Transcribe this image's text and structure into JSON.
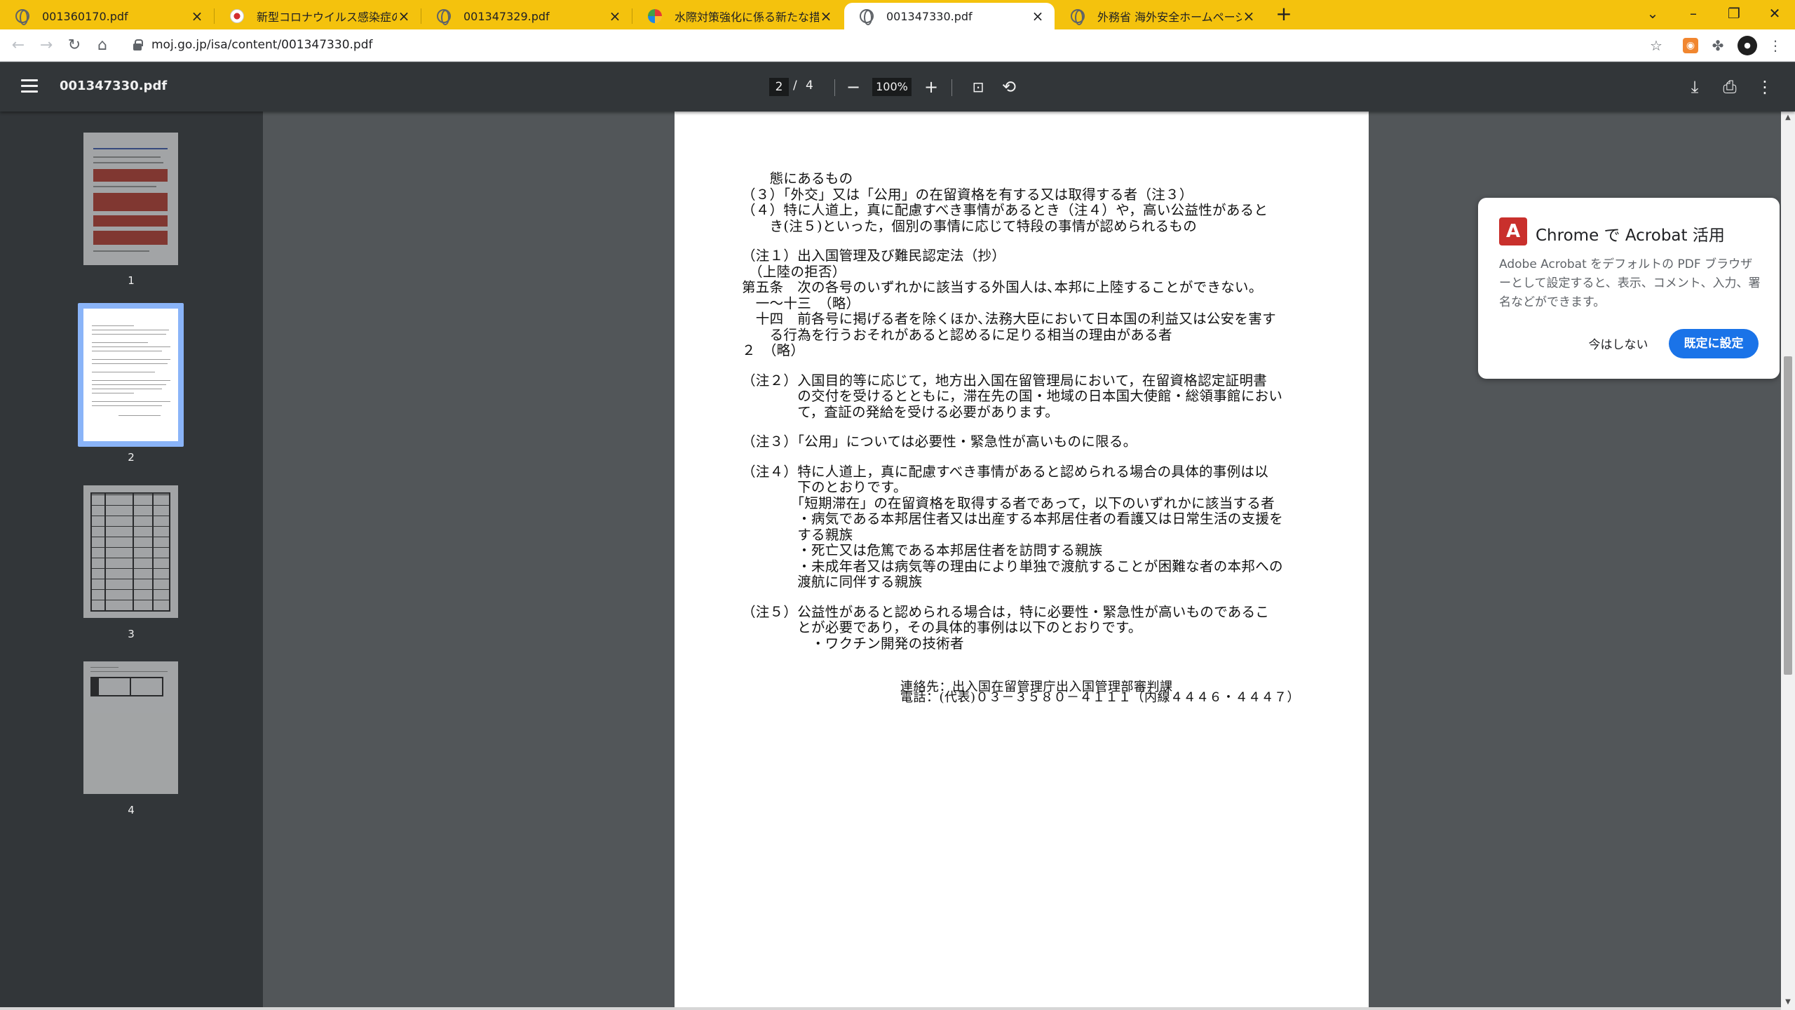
{
  "tabs": [
    {
      "title": "001360170.pdf",
      "icon": "globe-icon"
    },
    {
      "title": "新型コロナウイルス感染症の拡大防止",
      "icon": "flag-icon"
    },
    {
      "title": "001347329.pdf",
      "icon": "globe-icon"
    },
    {
      "title": "水際対策強化に係る新たな措置（",
      "icon": "emblem-icon"
    },
    {
      "title": "001347330.pdf",
      "icon": "globe-icon",
      "active": true
    },
    {
      "title": "外務省 海外安全ホームページ",
      "icon": "globe-icon"
    }
  ],
  "address": {
    "url": "moj.go.jp/isa/content/001347330.pdf"
  },
  "pdf": {
    "filename": "001347330.pdf",
    "current_page": "2",
    "page_separator": "/",
    "total_pages": "4",
    "zoom": "100%"
  },
  "thumbnails": [
    {
      "label": "1"
    },
    {
      "label": "2"
    },
    {
      "label": "3"
    },
    {
      "label": "4"
    }
  ],
  "document": {
    "lines": [
      "　　態にあるもの",
      "（３）「外交」又は「公用」の在留資格を有する又は取得する者（注３）",
      "（４）特に人道上，真に配慮すべき事情があるとき（注４）や，高い公益性があると",
      "　　き(注５)といった，個別の事情に応じて特段の事情が認められるもの",
      "",
      "（注１）出入国管理及び難民認定法（抄）",
      "　（上陸の拒否）",
      "第五条　次の各号のいずれかに該当する外国人は､本邦に上陸することができない。",
      "　一～十三　（略）",
      "　十四　前各号に掲げる者を除くほか､法務大臣において日本国の利益又は公安を害す",
      "　　る行為を行うおそれがあると認めるに足りる相当の理由がある者",
      "２　（略）",
      "",
      "（注２）入国目的等に応じて，地方出入国在留管理局において，在留資格認定証明書",
      "　　　　の交付を受けるとともに，滞在先の国・地域の日本国大使館・総領事館におい",
      "　　　　て，査証の発給を受ける必要があります。",
      "",
      "（注３）「公用」については必要性・緊急性が高いものに限る。",
      "",
      "（注４）特に人道上，真に配慮すべき事情があると認められる場合の具体的事例は以",
      "　　　　下のとおりです。",
      "　　　　「短期滞在」の在留資格を取得する者であって，以下のいずれかに該当する者",
      "　　　　・病気である本邦居住者又は出産する本邦居住者の看護又は日常生活の支援を",
      "　　　　する親族",
      "　　　　・死亡又は危篤である本邦居住者を訪問する親族",
      "　　　　・未成年者又は病気等の理由により単独で渡航することが困難な者の本邦への",
      "　　　　渡航に同伴する親族",
      "",
      "（注５）公益性があると認められる場合は，特に必要性・緊急性が高いものであるこ",
      "　　　　とが必要であり，その具体的事例は以下のとおりです。",
      "　　　　　・ワクチン開発の技術者"
    ],
    "contact_line1": "連絡先：出入国在留管理庁出入国管理部審判課",
    "contact_line2": "電話：(代表)０３－３５８０－４１１１（内線４４４６・４４４７）"
  },
  "popup": {
    "title": "Chrome で Acrobat 活用",
    "body": "Adobe Acrobat をデフォルトの PDF ブラウザーとして設定すると、表示、コメント、入力、署名などができます。",
    "dismiss_label": "今はしない",
    "confirm_label": "既定に設定"
  },
  "colors": {
    "tabstrip": "#f4c20d",
    "pdf_toolbar": "#323639",
    "viewer_bg": "#525659",
    "accent": "#1a73e8",
    "acrobat_red": "#c9302c"
  }
}
